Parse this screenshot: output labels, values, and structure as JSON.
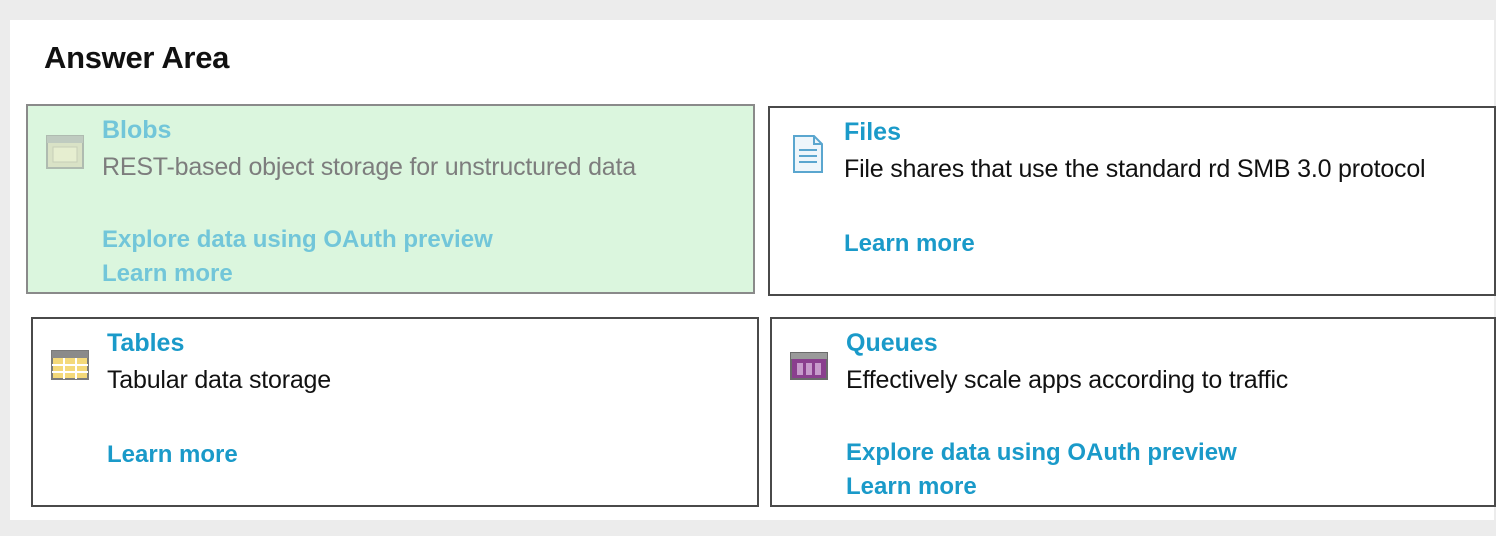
{
  "heading": "Answer Area",
  "cards": {
    "blobs": {
      "icon": "blob-storage-icon",
      "title": "Blobs",
      "description": "REST-based object storage for unstructured data",
      "explore_link": "Explore data using OAuth preview",
      "learn_link": "Learn more",
      "selected": true
    },
    "files": {
      "icon": "file-share-icon",
      "title": "Files",
      "description": "File shares that use the standard rd SMB 3.0 protocol",
      "learn_link": "Learn more"
    },
    "tables": {
      "icon": "table-storage-icon",
      "title": "Tables",
      "description": "Tabular data storage",
      "learn_link": "Learn more"
    },
    "queues": {
      "icon": "queue-storage-icon",
      "title": "Queues",
      "description": "Effectively scale apps according to traffic",
      "explore_link": "Explore data using OAuth preview",
      "learn_link": "Learn more"
    }
  },
  "colors": {
    "link_blue": "#1a9ac9",
    "selected_background": "#dbf6de"
  }
}
